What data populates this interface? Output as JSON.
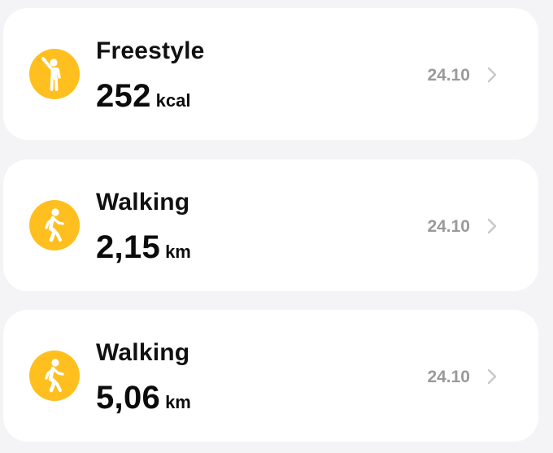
{
  "activities": [
    {
      "title": "Freestyle",
      "value": "252",
      "unit": "kcal",
      "date": "24.10",
      "icon": "freestyle-person-icon"
    },
    {
      "title": "Walking",
      "value": "2,15",
      "unit": "km",
      "date": "24.10",
      "icon": "walking-person-icon"
    },
    {
      "title": "Walking",
      "value": "5,06",
      "unit": "km",
      "date": "24.10",
      "icon": "walking-person-icon"
    }
  ],
  "colors": {
    "icon_background": "#ffbf1f",
    "card_background": "#ffffff",
    "page_background": "#f4f4f6",
    "date_text": "#9a9a9a"
  }
}
